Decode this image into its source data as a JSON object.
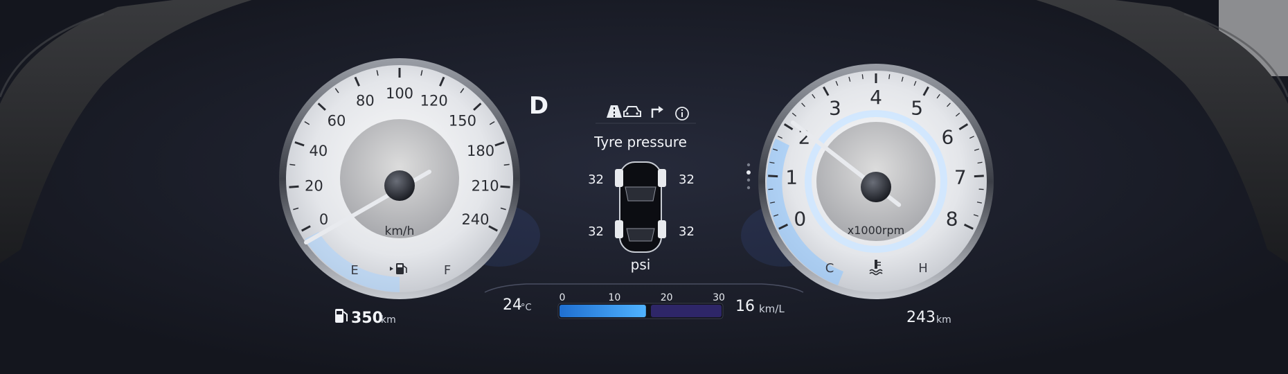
{
  "gear": "D",
  "speedometer": {
    "labels": [
      "0",
      "20",
      "40",
      "60",
      "80",
      "100",
      "120",
      "150",
      "180",
      "210",
      "240"
    ],
    "unit": "km/h",
    "fuel_empty": "E",
    "fuel_full": "F",
    "fuel_icon": "fuel-pump-icon",
    "needle_value_kmh": 0
  },
  "range": {
    "icon": "fuel-pump-icon",
    "value": "350",
    "unit": "km"
  },
  "info_panel": {
    "tabs": [
      {
        "icon": "lane-road-icon"
      },
      {
        "icon": "car-front-icon"
      },
      {
        "icon": "turn-arrow-icon"
      },
      {
        "icon": "info-icon"
      }
    ],
    "title": "Tyre pressure",
    "tyres": {
      "front_left": "32",
      "front_right": "32",
      "rear_left": "32",
      "rear_right": "32"
    },
    "unit": "psi"
  },
  "page_indicator": {
    "pages": 4,
    "active": 1
  },
  "temperature": {
    "value": "24",
    "unit": "°C"
  },
  "efficiency_bar": {
    "ticks": [
      "0",
      "10",
      "20",
      "30"
    ],
    "value": 16,
    "max": 30,
    "value_label": "16",
    "unit": "km/L",
    "color": "#2f8fe0"
  },
  "tachometer": {
    "labels": [
      "0",
      "1",
      "2",
      "3",
      "4",
      "5",
      "6",
      "7",
      "8"
    ],
    "unit": "x1000rpm",
    "cold": "C",
    "hot": "H",
    "temp_icon": "coolant-temperature-icon",
    "needle_value_krpm": 2.2
  },
  "odometer": {
    "value": "243",
    "unit": "km"
  },
  "colors": {
    "background": "#1a1c26",
    "accent_blue": "#4aa3ff",
    "text": "#f2f4f8"
  }
}
